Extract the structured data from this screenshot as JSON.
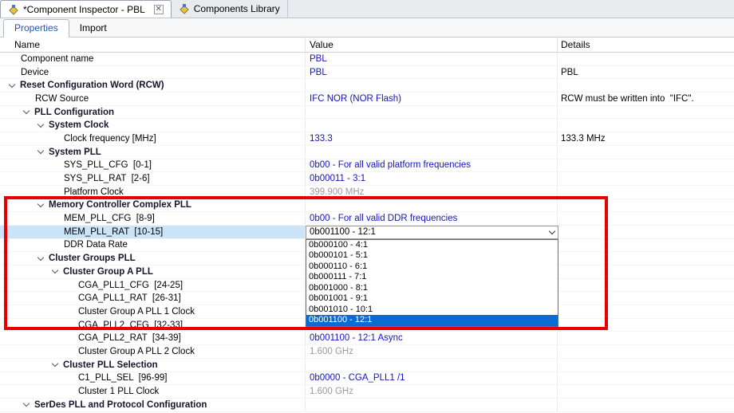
{
  "colors": {
    "value_blue": "#1414c2",
    "value_gray": "#9a9aa0",
    "selected_row_bg": "#cbe4f8",
    "dropdown_selected_bg": "#0a6cd0",
    "annotation_red": "#e60000"
  },
  "editor_tabs": [
    {
      "label": "*Component Inspector - PBL",
      "active": true,
      "close_glyph": "✕"
    },
    {
      "label": "Components Library",
      "active": false
    }
  ],
  "view_tabs": [
    {
      "label": "Properties",
      "active": true
    },
    {
      "label": "Import",
      "active": false
    }
  ],
  "table": {
    "headers": [
      "Name",
      "Value",
      "Details"
    ],
    "rows": [
      {
        "name": "Component name",
        "level": 0,
        "group": false,
        "value": "PBL",
        "style": "blue",
        "details": ""
      },
      {
        "name": "Device",
        "level": 0,
        "group": false,
        "value": "PBL",
        "style": "blue",
        "details": "PBL"
      },
      {
        "name": "Reset Configuration Word (RCW)",
        "level": 0,
        "group": true,
        "value": "",
        "details": ""
      },
      {
        "name": "RCW Source",
        "level": 1,
        "group": false,
        "value": "IFC NOR (NOR Flash)",
        "style": "blue",
        "details": "RCW must be written into  \"IFC\"."
      },
      {
        "name": "PLL Configuration",
        "level": 1,
        "group": true,
        "value": "",
        "details": ""
      },
      {
        "name": "System Clock",
        "level": 2,
        "group": true,
        "value": "",
        "details": ""
      },
      {
        "name": "Clock frequency [MHz]",
        "level": 3,
        "group": false,
        "value": "133.3",
        "style": "blue",
        "details": "133.3 MHz"
      },
      {
        "name": "System PLL",
        "level": 2,
        "group": true,
        "value": "",
        "details": ""
      },
      {
        "name": "SYS_PLL_CFG  [0-1]",
        "level": 3,
        "group": false,
        "value": "0b00 - For all valid platform frequencies",
        "style": "blue",
        "details": ""
      },
      {
        "name": "SYS_PLL_RAT  [2-6]",
        "level": 3,
        "group": false,
        "value": "0b00011 - 3:1",
        "style": "blue",
        "details": ""
      },
      {
        "name": "Platform Clock",
        "level": 3,
        "group": false,
        "value": "399.900 MHz",
        "style": "gray",
        "details": ""
      },
      {
        "name": "Memory Controller Complex PLL",
        "level": 2,
        "group": true,
        "value": "",
        "details": ""
      },
      {
        "name": "MEM_PLL_CFG  [8-9]",
        "level": 3,
        "group": false,
        "value": "0b00 - For all valid DDR frequencies",
        "style": "blue",
        "details": ""
      },
      {
        "name": "MEM_PLL_RAT  [10-15]",
        "level": 3,
        "group": false,
        "selected": true,
        "value": "",
        "details": ""
      },
      {
        "name": "DDR Data Rate",
        "level": 3,
        "group": false,
        "value": "",
        "details": ""
      },
      {
        "name": "Cluster Groups PLL",
        "level": 2,
        "group": true,
        "value": "",
        "details": ""
      },
      {
        "name": "Cluster Group A PLL",
        "level": 3,
        "group": true,
        "value": "",
        "details": ""
      },
      {
        "name": "CGA_PLL1_CFG  [24-25]",
        "level": 4,
        "group": false,
        "value": "",
        "details": ""
      },
      {
        "name": "CGA_PLL1_RAT  [26-31]",
        "level": 4,
        "group": false,
        "value": "",
        "details": ""
      },
      {
        "name": "Cluster Group A PLL 1 Clock",
        "level": 4,
        "group": false,
        "value": "",
        "details": ""
      },
      {
        "name": "CGA_PLL2_CFG  [32-33]",
        "level": 4,
        "group": false,
        "value": "",
        "details": ""
      },
      {
        "name": "CGA_PLL2_RAT  [34-39]",
        "level": 4,
        "group": false,
        "value": "0b001100 - 12:1 Async",
        "style": "blue",
        "details": ""
      },
      {
        "name": "Cluster Group A PLL 2 Clock",
        "level": 4,
        "group": false,
        "value": "1.600 GHz",
        "style": "gray",
        "details": ""
      },
      {
        "name": "Cluster PLL Selection",
        "level": 3,
        "group": true,
        "value": "",
        "details": ""
      },
      {
        "name": "C1_PLL_SEL  [96-99]",
        "level": 4,
        "group": false,
        "value": "0b0000 - CGA_PLL1 /1",
        "style": "blue",
        "details": ""
      },
      {
        "name": "Cluster 1 PLL Clock",
        "level": 4,
        "group": false,
        "value": "1.600 GHz",
        "style": "gray",
        "details": ""
      },
      {
        "name": "SerDes PLL and Protocol Configuration",
        "level": 1,
        "group": true,
        "value": "",
        "details": ""
      }
    ]
  },
  "combo": {
    "value": "0b001100 - 12:1",
    "options": [
      "0b000100 - 4:1",
      "0b000101 - 5:1",
      "0b000110 - 6:1",
      "0b000111 - 7:1",
      "0b001000 - 8:1",
      "0b001001 - 9:1",
      "0b001010 - 10:1",
      "0b001100 - 12:1"
    ],
    "selected_index": 7
  }
}
